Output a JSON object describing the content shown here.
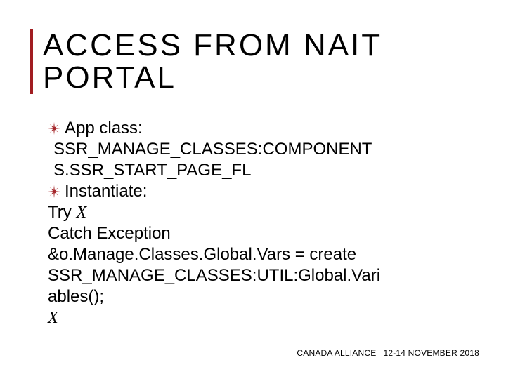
{
  "colors": {
    "accent": "#a11d21"
  },
  "title": {
    "line1": "ACCESS FROM NAIT",
    "line2": "PORTAL"
  },
  "body": {
    "bullet1_label": "App class:",
    "bullet1_cont1": "SSR_MANAGE_CLASSES:COMPONENT",
    "bullet1_cont2": "S.SSR_START_PAGE_FL",
    "bullet2_label": "Instantiate:",
    "line_try_prefix": "Try ",
    "line_try_x": "X",
    "line_catch": "Catch Exception",
    "line_assign1": " &o.Manage.Classes.Global.Vars = create",
    "line_assign2": "SSR_MANAGE_CLASSES:UTIL:Global.Vari",
    "line_assign3": "ables();",
    "line_final_x": "X"
  },
  "footer": {
    "org": "CANADA ALLIANCE",
    "dates": "12-14 NOVEMBER 2018"
  }
}
